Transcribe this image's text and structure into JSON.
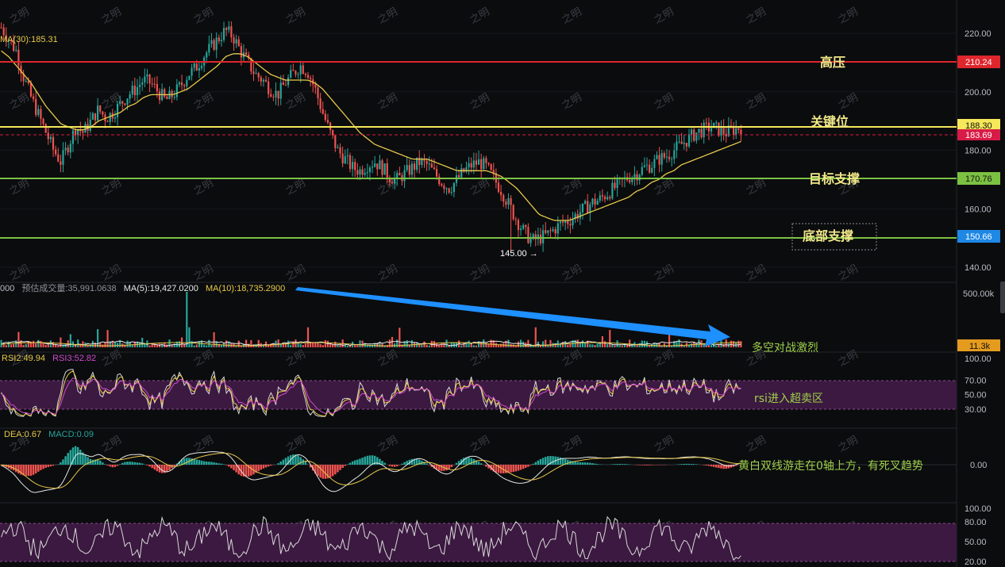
{
  "chart_data": [
    {
      "type": "candlestick",
      "panel": "price",
      "legend_ma30": "MA(30):185.31",
      "y_ticks": [
        "220.00",
        "200.00",
        "180.00",
        "160.00",
        "140.00"
      ],
      "ylim": [
        140,
        222
      ],
      "close_series": [
        222,
        218,
        214,
        205,
        198,
        192,
        186,
        180,
        176,
        182,
        188,
        186,
        190,
        194,
        191,
        193,
        196,
        199,
        201,
        204,
        203,
        200,
        197,
        199,
        202,
        206,
        208,
        212,
        215,
        218,
        221,
        219,
        214,
        210,
        206,
        204,
        201,
        199,
        203,
        206,
        209,
        207,
        201,
        193,
        186,
        180,
        177,
        174,
        173,
        175,
        176,
        174,
        171,
        170,
        172,
        174,
        176,
        175,
        172,
        169,
        167,
        170,
        173,
        175,
        176,
        174,
        170,
        166,
        161,
        156,
        152,
        149,
        150,
        151,
        153,
        155,
        156,
        158,
        160,
        162,
        163,
        165,
        167,
        169,
        171,
        172,
        174,
        175,
        177,
        178,
        180,
        182,
        184,
        186,
        187,
        188,
        187,
        186,
        187,
        188
      ],
      "ma30_series": [
        214,
        212,
        209,
        206,
        203,
        199,
        195,
        192,
        189,
        188,
        187,
        187,
        188,
        190,
        191,
        192,
        193,
        195,
        196,
        198,
        199,
        199,
        199,
        199,
        200,
        201,
        203,
        205,
        207,
        209,
        212,
        213,
        213,
        212,
        210,
        208,
        206,
        205,
        204,
        204,
        204,
        204,
        203,
        201,
        198,
        195,
        192,
        189,
        186,
        184,
        182,
        181,
        180,
        179,
        178,
        177,
        177,
        177,
        176,
        175,
        174,
        173,
        173,
        173,
        173,
        173,
        172,
        171,
        169,
        167,
        164,
        161,
        158,
        157,
        156,
        156,
        156,
        157,
        158,
        159,
        160,
        161,
        162,
        163,
        164,
        166,
        167,
        169,
        170,
        172,
        173,
        175,
        176,
        177,
        178,
        179,
        180,
        181,
        182,
        183
      ],
      "low_marker": "145.00 →",
      "levels": [
        {
          "label": "高压",
          "value": "210.24",
          "color": "#e0262d"
        },
        {
          "label": "关键位",
          "value": "188.30",
          "color": "#f5e85a"
        },
        {
          "label": "目标支撑",
          "value": "170.76",
          "color": "#7cc242"
        },
        {
          "label": "底部支撑",
          "value": "150.66",
          "color": "#1e88e5"
        }
      ],
      "current_price": "183.69",
      "current_price_color": "#d81b46"
    },
    {
      "type": "bar",
      "panel": "volume",
      "legend_prefix": "000",
      "legend_est": "预估成交量:35,991.0638",
      "legend_ma5": "MA(5):19,427.0200",
      "legend_ma10": "MA(10):18,735.2900",
      "y_ticks": [
        "500.00k"
      ],
      "last_value": "11.3k",
      "annotation": "多空对战激烈"
    },
    {
      "type": "line",
      "panel": "rsi",
      "legend_rsi2": "RSI2:49.94",
      "legend_rsi3": "RSI3:52.82",
      "y_ticks": [
        "100.00",
        "70.00",
        "50.00",
        "30.00"
      ],
      "annotation": "rsi进入超卖区"
    },
    {
      "type": "bar",
      "panel": "macd",
      "legend_dea": "DEA:0.67",
      "legend_macd": "MACD:0.09",
      "y_ticks": [
        "0.00"
      ],
      "annotation": "黄白双线游走在0轴上方，有死叉趋势"
    },
    {
      "type": "line",
      "panel": "oscillator",
      "y_ticks": [
        "100.00",
        "80.00",
        "50.00",
        "20.00"
      ]
    }
  ],
  "watermark": "之明"
}
